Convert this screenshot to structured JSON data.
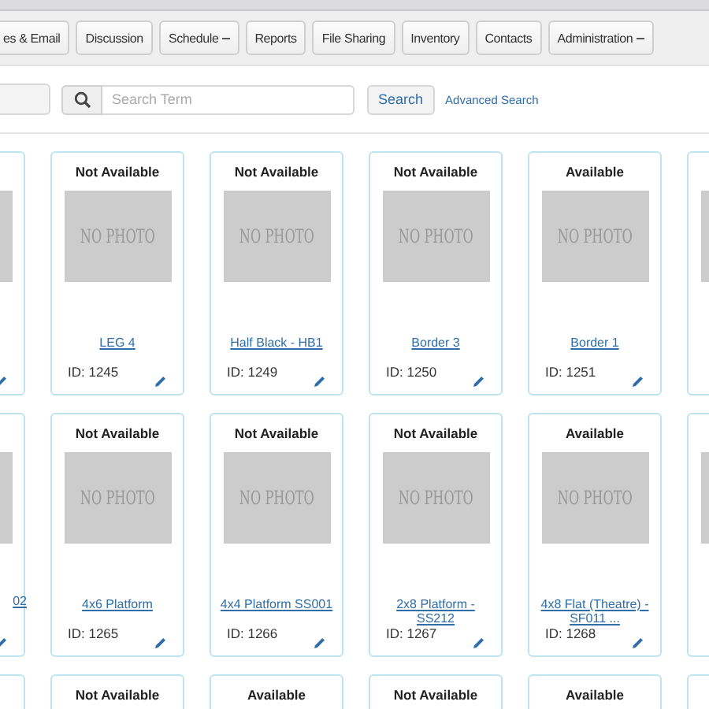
{
  "nav": {
    "items": [
      {
        "label": "es & Email",
        "dropdown": false
      },
      {
        "label": "Discussion",
        "dropdown": false
      },
      {
        "label": "Schedule",
        "dropdown": true
      },
      {
        "label": "Reports",
        "dropdown": false
      },
      {
        "label": "File Sharing",
        "dropdown": false
      },
      {
        "label": "Inventory",
        "dropdown": false
      },
      {
        "label": "Contacts",
        "dropdown": false
      },
      {
        "label": "Administration",
        "dropdown": true
      }
    ]
  },
  "search": {
    "placeholder": "Search Term",
    "button": "Search",
    "advanced_link": "Advanced Search"
  },
  "grid": {
    "rows": [
      {
        "cards": [
          {
            "kind": "partial"
          },
          {
            "kind": "full",
            "status": "Not Available",
            "photo_text": "NO PHOTO",
            "title": "LEG 4",
            "id": "ID: 1245"
          },
          {
            "kind": "full",
            "status": "Not Available",
            "photo_text": "NO PHOTO",
            "title": "Half Black - HB1",
            "id": "ID: 1249"
          },
          {
            "kind": "full",
            "status": "Not Available",
            "photo_text": "NO PHOTO",
            "title": "Border 3",
            "id": "ID: 1250"
          },
          {
            "kind": "full",
            "status": "Available",
            "photo_text": "NO PHOTO",
            "title": "Border 1",
            "id": "ID: 1251"
          },
          {
            "kind": "partial"
          }
        ]
      },
      {
        "cards": [
          {
            "kind": "partial",
            "title": "02"
          },
          {
            "kind": "full",
            "status": "Not Available",
            "photo_text": "NO PHOTO",
            "title": "4x6 Platform",
            "id": "ID: 1265"
          },
          {
            "kind": "full",
            "status": "Not Available",
            "photo_text": "NO PHOTO",
            "title": "4x4 Platform SS001",
            "id": "ID: 1266"
          },
          {
            "kind": "full",
            "status": "Not Available",
            "photo_text": "NO PHOTO",
            "title": "2x8 Platform - SS212",
            "id": "ID: 1267"
          },
          {
            "kind": "full",
            "status": "Available",
            "photo_text": "NO PHOTO",
            "title": "4x8 Flat (Theatre) - SF011 ...",
            "id": "ID: 1268"
          },
          {
            "kind": "partial"
          }
        ]
      },
      {
        "cards": [
          {
            "kind": "partial"
          },
          {
            "kind": "full",
            "status": "Not Available"
          },
          {
            "kind": "full",
            "status": "Available"
          },
          {
            "kind": "full",
            "status": "Not Available"
          },
          {
            "kind": "full",
            "status": "Available"
          },
          {
            "kind": "partial"
          }
        ]
      }
    ]
  }
}
